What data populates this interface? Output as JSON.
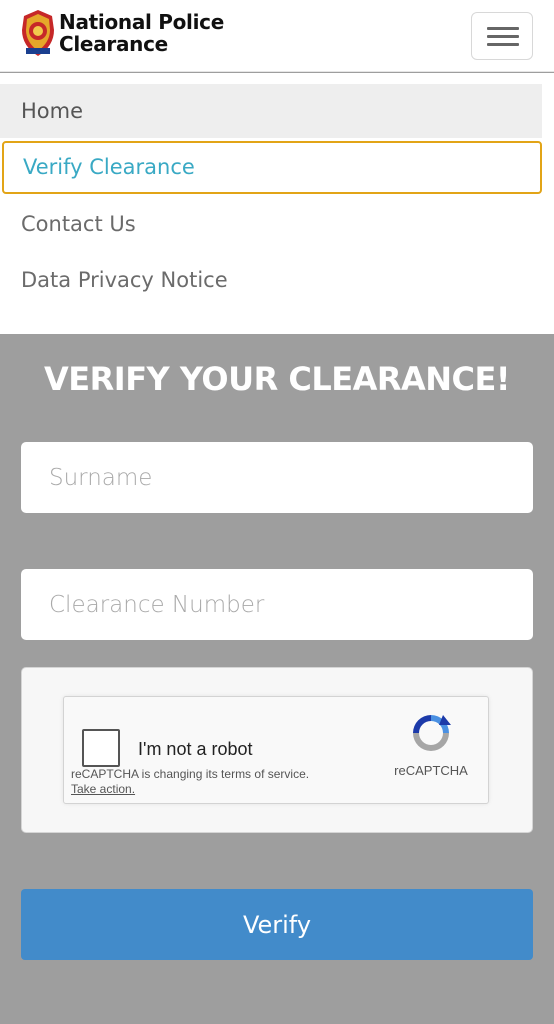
{
  "header": {
    "brand_line1": "National Police",
    "brand_line2": "Clearance",
    "logo_icon": "pnp-badge-icon",
    "menu_icon": "hamburger-menu-icon"
  },
  "nav": {
    "items": [
      {
        "label": "Home"
      },
      {
        "label": "Verify Clearance"
      },
      {
        "label": "Contact Us"
      },
      {
        "label": "Data Privacy Notice"
      }
    ]
  },
  "main": {
    "title": "VERIFY YOUR CLEARANCE!",
    "surname_placeholder": "Surname",
    "clearance_placeholder": "Clearance Number",
    "verify_label": "Verify"
  },
  "captcha": {
    "label": "I'm not a robot",
    "notice": "reCAPTCHA is changing its terms of service.",
    "action": "Take action.",
    "brand": "reCAPTCHA",
    "logo_icon": "recaptcha-logo-icon"
  },
  "colors": {
    "accent_link": "#39a9c4",
    "focus_border": "#e2a417",
    "button": "#428bca",
    "page_bg": "#9e9e9e"
  }
}
